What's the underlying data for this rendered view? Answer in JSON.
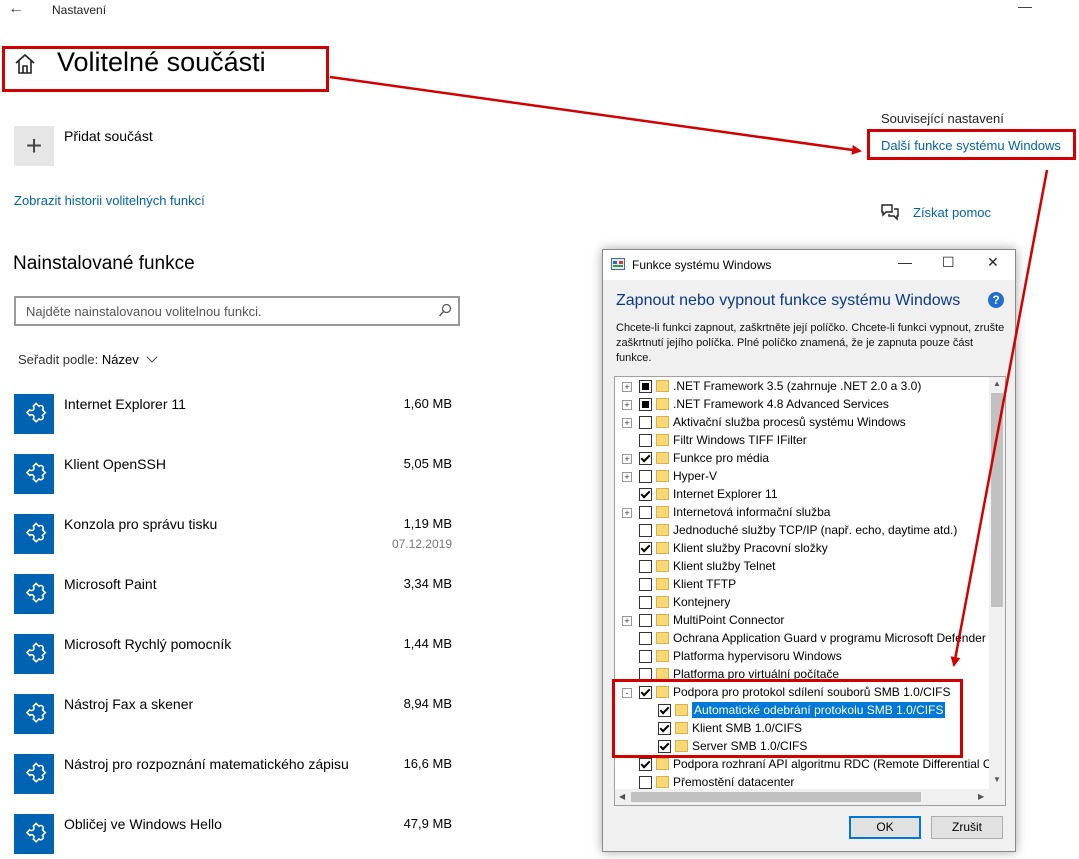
{
  "window": {
    "app_title": "Nastavení",
    "back_icon": "back-arrow-icon",
    "min_icon": "minimize-icon"
  },
  "page": {
    "title": "Volitelné součásti",
    "home_icon": "home-icon"
  },
  "add": {
    "label": "Přidat součást",
    "icon": "plus-icon"
  },
  "history_link": "Zobrazit historii volitelných funkcí",
  "installed": {
    "title": "Nainstalované funkce",
    "search_placeholder": "Najděte nainstalovanou volitelnou funkci.",
    "sort_prefix": "Seřadit podle:",
    "sort_value": "Název"
  },
  "features": [
    {
      "name": "Internet Explorer 11",
      "size": "1,60 MB",
      "date": ""
    },
    {
      "name": "Klient OpenSSH",
      "size": "5,05 MB",
      "date": ""
    },
    {
      "name": "Konzola pro správu tisku",
      "size": "1,19 MB",
      "date": "07.12.2019"
    },
    {
      "name": "Microsoft Paint",
      "size": "3,34 MB",
      "date": ""
    },
    {
      "name": "Microsoft Rychlý pomocník",
      "size": "1,44 MB",
      "date": ""
    },
    {
      "name": "Nástroj Fax a skener",
      "size": "8,94 MB",
      "date": ""
    },
    {
      "name": "Nástroj pro rozpoznání matematického zápisu",
      "size": "16,6 MB",
      "date": ""
    },
    {
      "name": "Obličej ve Windows Hello",
      "size": "47,9 MB",
      "date": ""
    }
  ],
  "related": {
    "title": "Související nastavení",
    "link": "Další funkce systému Windows",
    "help": "Získat pomoc"
  },
  "dialog": {
    "title": "Funkce systému Windows",
    "heading": "Zapnout nebo vypnout funkce systému Windows",
    "description": "Chcete-li funkci zapnout, zaškrtněte její políčko. Chcete-li funkci vypnout, zrušte zaškrtnutí jejího políčka. Plné políčko znamená, že je zapnuta pouze část funkce.",
    "ok": "OK",
    "cancel": "Zrušit",
    "items": [
      {
        "label": ".NET Framework 3.5 (zahrnuje .NET 2.0 a 3.0)",
        "state": "partial",
        "expand": "+",
        "level": 0
      },
      {
        "label": ".NET Framework 4.8 Advanced Services",
        "state": "partial",
        "expand": "+",
        "level": 0
      },
      {
        "label": "Aktivační služba procesů systému Windows",
        "state": "unchecked",
        "expand": "+",
        "level": 0
      },
      {
        "label": "Filtr Windows TIFF IFilter",
        "state": "unchecked",
        "expand": "",
        "level": 0
      },
      {
        "label": "Funkce pro média",
        "state": "checked",
        "expand": "+",
        "level": 0
      },
      {
        "label": "Hyper-V",
        "state": "unchecked",
        "expand": "+",
        "level": 0
      },
      {
        "label": "Internet Explorer 11",
        "state": "checked",
        "expand": "",
        "level": 0
      },
      {
        "label": "Internetová informační služba",
        "state": "unchecked",
        "expand": "+",
        "level": 0
      },
      {
        "label": "Jednoduché služby TCP/IP (např. echo, daytime atd.)",
        "state": "unchecked",
        "expand": "",
        "level": 0
      },
      {
        "label": "Klient služby Pracovní složky",
        "state": "checked",
        "expand": "",
        "level": 0
      },
      {
        "label": "Klient služby Telnet",
        "state": "unchecked",
        "expand": "",
        "level": 0
      },
      {
        "label": "Klient TFTP",
        "state": "unchecked",
        "expand": "",
        "level": 0
      },
      {
        "label": "Kontejnery",
        "state": "unchecked",
        "expand": "",
        "level": 0
      },
      {
        "label": "MultiPoint Connector",
        "state": "unchecked",
        "expand": "+",
        "level": 0
      },
      {
        "label": "Ochrana Application Guard v programu Microsoft Defender",
        "state": "unchecked",
        "expand": "",
        "level": 0
      },
      {
        "label": "Platforma hypervisoru Windows",
        "state": "unchecked",
        "expand": "",
        "level": 0
      },
      {
        "label": "Platforma pro virtuální počítače",
        "state": "unchecked",
        "expand": "",
        "level": 0
      },
      {
        "label": "Podpora pro protokol sdílení souborů SMB 1.0/CIFS",
        "state": "checked",
        "expand": "-",
        "level": 0
      },
      {
        "label": "Automatické odebrání protokolu SMB 1.0/CIFS",
        "state": "checked",
        "expand": "",
        "level": 1,
        "selected": true
      },
      {
        "label": "Klient SMB 1.0/CIFS",
        "state": "checked",
        "expand": "",
        "level": 1
      },
      {
        "label": "Server SMB 1.0/CIFS",
        "state": "checked",
        "expand": "",
        "level": 1
      },
      {
        "label": "Podpora rozhraní API algoritmu RDC (Remote Differential Co",
        "state": "checked",
        "expand": "",
        "level": 0
      },
      {
        "label": "Přemostění datacenter",
        "state": "unchecked",
        "expand": "",
        "level": 0
      }
    ]
  },
  "colors": {
    "accent": "#0063b1",
    "highlight": "#d40000",
    "selection": "#0078d7"
  }
}
